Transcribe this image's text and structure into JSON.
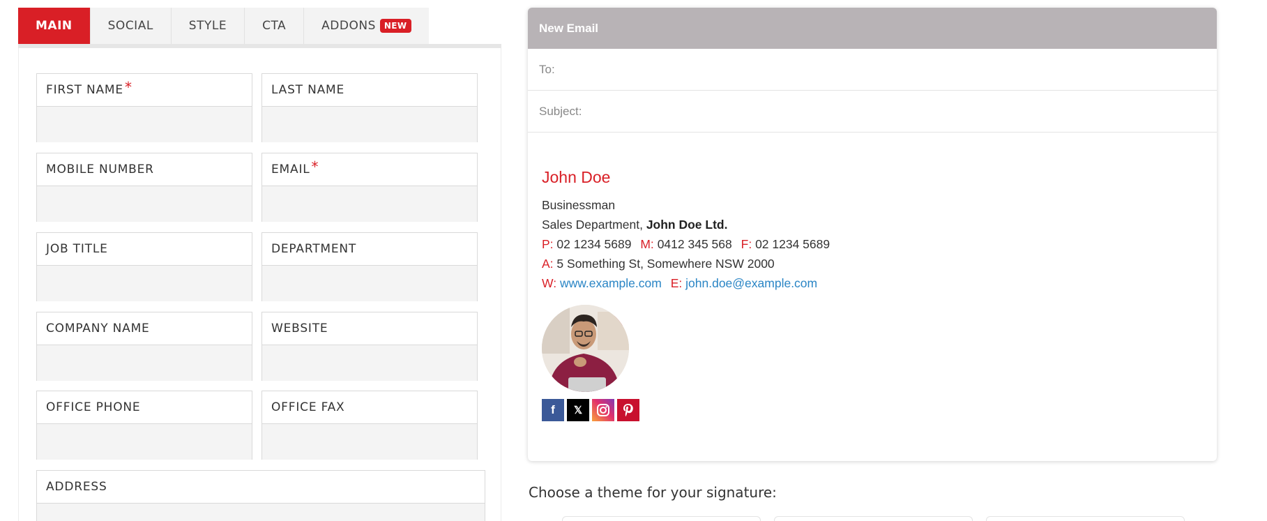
{
  "tabs": [
    {
      "label": "MAIN",
      "active": true
    },
    {
      "label": "SOCIAL"
    },
    {
      "label": "STYLE"
    },
    {
      "label": "CTA"
    },
    {
      "label": "ADDONS",
      "badge": "NEW"
    }
  ],
  "form": {
    "first_name": {
      "label": "FIRST NAME",
      "required": "*",
      "value": ""
    },
    "last_name": {
      "label": "LAST NAME",
      "value": ""
    },
    "mobile": {
      "label": "MOBILE NUMBER",
      "value": ""
    },
    "email": {
      "label": "EMAIL",
      "required": "*",
      "value": ""
    },
    "job_title": {
      "label": "JOB TITLE",
      "value": ""
    },
    "department": {
      "label": "DEPARTMENT",
      "value": ""
    },
    "company": {
      "label": "COMPANY NAME",
      "value": ""
    },
    "website": {
      "label": "WEBSITE",
      "value": ""
    },
    "office_phone": {
      "label": "OFFICE PHONE",
      "value": ""
    },
    "office_fax": {
      "label": "OFFICE FAX",
      "value": ""
    },
    "address": {
      "label": "ADDRESS",
      "value": ""
    }
  },
  "email": {
    "header": "New Email",
    "to_label": "To:",
    "subject_label": "Subject:"
  },
  "signature": {
    "name": "John Doe",
    "title": "Businessman",
    "department": "Sales Department,",
    "company": "John Doe Ltd.",
    "phone_label": "P:",
    "phone": "02 1234 5689",
    "mobile_label": "M:",
    "mobile": "0412 345 568",
    "fax_label": "F:",
    "fax": "02 1234 5689",
    "address_label": "A:",
    "address": "5 Something St,  Somewhere NSW 2000",
    "web_label": "W:",
    "web": "www.example.com",
    "email_label": "E:",
    "email": "john.doe@example.com",
    "social": [
      {
        "name": "facebook-icon",
        "glyph": "f"
      },
      {
        "name": "x-icon",
        "glyph": "𝕏"
      },
      {
        "name": "instagram-icon",
        "glyph": "◎"
      },
      {
        "name": "pinterest-icon",
        "glyph": "P"
      }
    ]
  },
  "choose_theme": "Choose a theme for your signature:",
  "colors": {
    "accent": "#d91f26",
    "header_bg": "#b8b3b6",
    "link": "#2a85c5"
  }
}
